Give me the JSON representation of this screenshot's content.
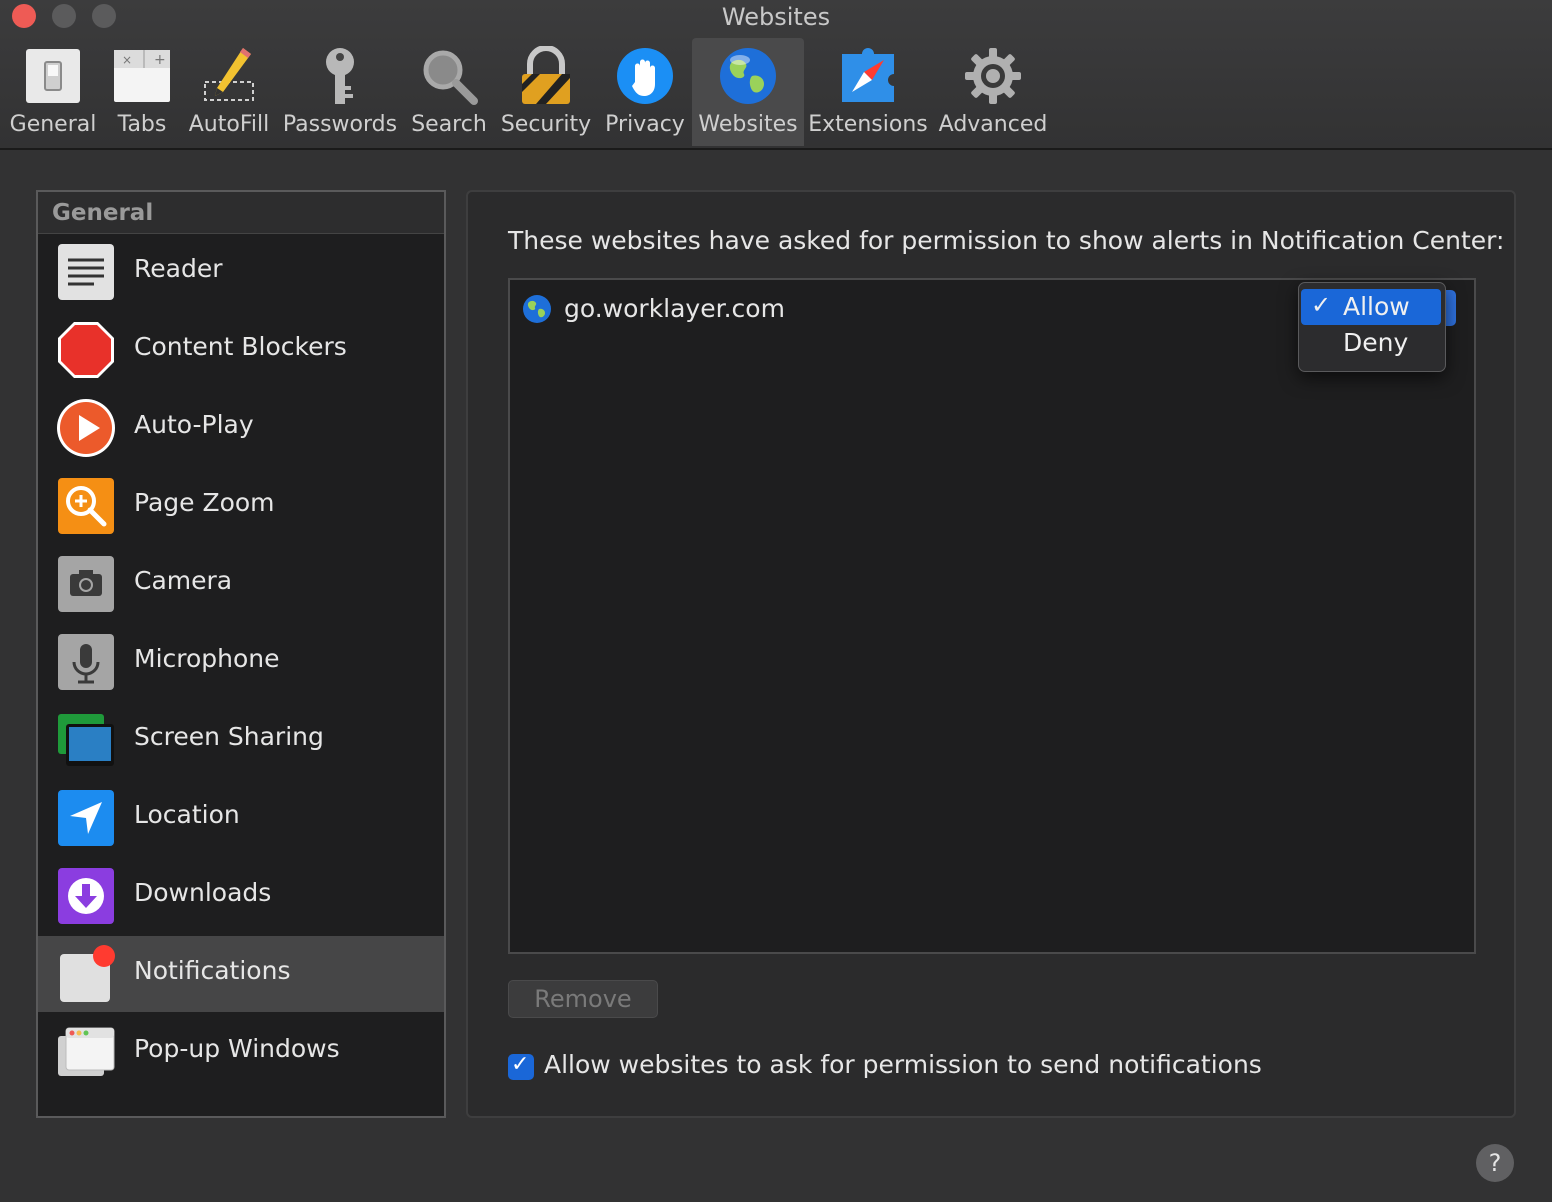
{
  "window": {
    "title": "Websites"
  },
  "toolbar": {
    "items": [
      {
        "label": "General"
      },
      {
        "label": "Tabs"
      },
      {
        "label": "AutoFill"
      },
      {
        "label": "Passwords"
      },
      {
        "label": "Search"
      },
      {
        "label": "Security"
      },
      {
        "label": "Privacy"
      },
      {
        "label": "Websites"
      },
      {
        "label": "Extensions"
      },
      {
        "label": "Advanced"
      }
    ],
    "active": "Websites"
  },
  "sidebar": {
    "header": "General",
    "items": [
      {
        "label": "Reader",
        "icon": "reader-icon"
      },
      {
        "label": "Content Blockers",
        "icon": "stop-sign-icon"
      },
      {
        "label": "Auto-Play",
        "icon": "play-icon"
      },
      {
        "label": "Page Zoom",
        "icon": "zoom-icon"
      },
      {
        "label": "Camera",
        "icon": "camera-icon"
      },
      {
        "label": "Microphone",
        "icon": "microphone-icon"
      },
      {
        "label": "Screen Sharing",
        "icon": "screen-sharing-icon"
      },
      {
        "label": "Location",
        "icon": "location-arrow-icon"
      },
      {
        "label": "Downloads",
        "icon": "download-icon"
      },
      {
        "label": "Notifications",
        "icon": "notification-icon"
      },
      {
        "label": "Pop-up Windows",
        "icon": "popup-window-icon"
      }
    ],
    "selected": "Notifications"
  },
  "panel": {
    "description": "These websites have asked for permission to show alerts in Notification Center:",
    "sites": [
      {
        "domain": "go.worklayer.com",
        "setting": "Allow"
      }
    ],
    "dropdown": {
      "options": [
        "Allow",
        "Deny"
      ],
      "selected": "Allow",
      "check_glyph": "✓"
    },
    "remove_label": "Remove",
    "allow_ask_label": "Allow websites to ask for permission to send notifications",
    "allow_ask_checked": true
  },
  "help": {
    "label": "?"
  },
  "colors": {
    "accent": "#1a67d8",
    "close": "#ee5b55",
    "background": "#323233"
  }
}
